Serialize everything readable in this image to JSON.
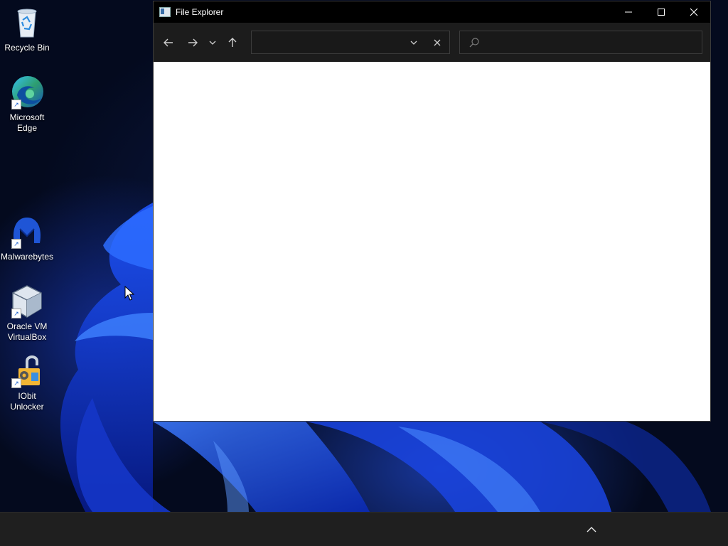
{
  "desktop": {
    "icons": [
      {
        "label": "Recycle Bin",
        "icon": "recycle-bin-icon"
      },
      {
        "label": "Microsoft Edge",
        "icon": "edge-icon"
      },
      {
        "label": "Malwarebytes",
        "icon": "malwarebytes-icon"
      },
      {
        "label": "Oracle VM VirtualBox",
        "icon": "virtualbox-icon"
      },
      {
        "label": "IObit Unlocker",
        "icon": "iobit-unlocker-icon"
      }
    ]
  },
  "window": {
    "title": "File Explorer",
    "controls": {
      "minimize": "—",
      "maximize": "☐",
      "close": "✕"
    },
    "toolbar": {
      "back": "←",
      "forward": "→",
      "recent": "⌄",
      "up": "↑",
      "address_value": "",
      "address_dropdown": "⌄",
      "address_clear": "✕",
      "search_value": ""
    }
  },
  "taskbar": {
    "tray_chevron": "^"
  },
  "colors": {
    "taskbar": "#1f1f1f",
    "titlebar": "#000000",
    "toolbar": "#1c1c1c",
    "content": "#ffffff"
  }
}
